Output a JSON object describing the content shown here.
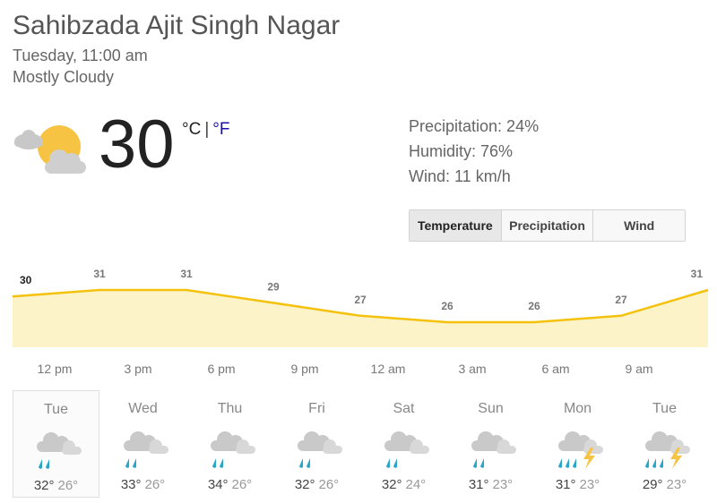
{
  "header": {
    "location": "Sahibzada Ajit Singh Nagar",
    "datetime": "Tuesday, 11:00 am",
    "condition": "Mostly Cloudy"
  },
  "current": {
    "temperature": "30",
    "unit_c": "°C",
    "unit_sep": "|",
    "unit_f": "°F",
    "icon": "partly-cloudy-icon",
    "precipitation": "Precipitation: 24%",
    "humidity": "Humidity: 76%",
    "wind": "Wind: 11 km/h"
  },
  "tabs": [
    {
      "label": "Temperature",
      "active": true
    },
    {
      "label": "Precipitation",
      "active": false
    },
    {
      "label": "Wind",
      "active": false
    }
  ],
  "chart_data": {
    "type": "area",
    "x": [
      "12 pm",
      "3 pm",
      "6 pm",
      "9 pm",
      "12 am",
      "3 am",
      "6 am",
      "9 am"
    ],
    "values": [
      30,
      31,
      31,
      29,
      27,
      26,
      26,
      27,
      31
    ],
    "labels": [
      "30",
      "31",
      "31",
      "29",
      "27",
      "26",
      "26",
      "27",
      "31"
    ],
    "colors": {
      "line": "#f4c20d",
      "fill": "#fdf3c8"
    }
  },
  "forecast": [
    {
      "day": "Tue",
      "hi": "32°",
      "lo": "26°",
      "icon": "rain-icon"
    },
    {
      "day": "Wed",
      "hi": "33°",
      "lo": "26°",
      "icon": "rain-icon"
    },
    {
      "day": "Thu",
      "hi": "34°",
      "lo": "26°",
      "icon": "rain-icon"
    },
    {
      "day": "Fri",
      "hi": "32°",
      "lo": "26°",
      "icon": "rain-icon"
    },
    {
      "day": "Sat",
      "hi": "32°",
      "lo": "24°",
      "icon": "rain-icon"
    },
    {
      "day": "Sun",
      "hi": "31°",
      "lo": "23°",
      "icon": "rain-icon"
    },
    {
      "day": "Mon",
      "hi": "31°",
      "lo": "23°",
      "icon": "thunderstorm-icon"
    },
    {
      "day": "Tue",
      "hi": "29°",
      "lo": "23°",
      "icon": "thunderstorm-icon"
    }
  ]
}
